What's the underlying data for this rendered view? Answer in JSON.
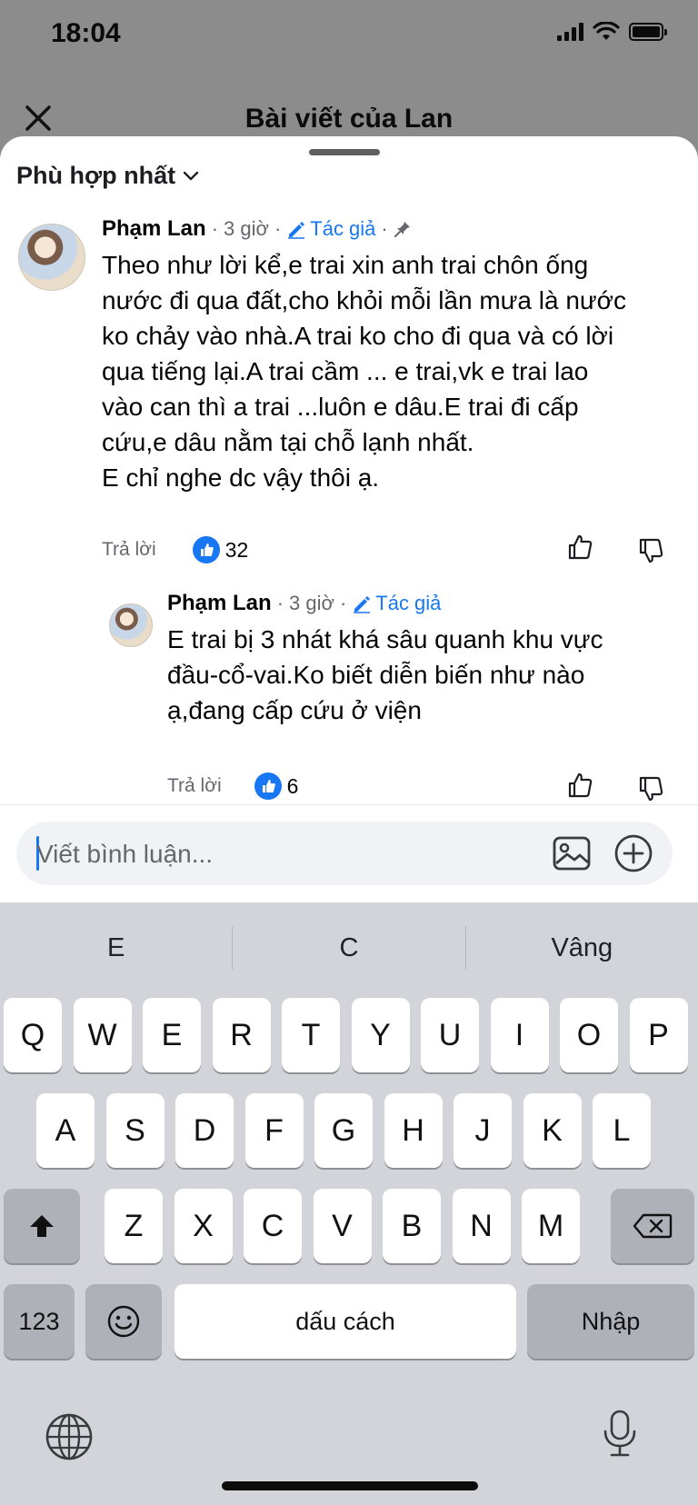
{
  "status_bar": {
    "time": "18:04"
  },
  "header": {
    "title": "Bài viết của Lan"
  },
  "sort": {
    "label": "Phù hợp nhất"
  },
  "comments": [
    {
      "name": "Phạm Lan",
      "time": "3 giờ",
      "author_badge": "Tác giả",
      "pinned": true,
      "text_lines": [
        "Theo như lời kể,e trai xin anh trai chôn ống",
        "nước đi qua đất,cho khỏi mỗi lần mưa là nước",
        "ko chảy vào nhà.A trai ko cho đi qua và có lời",
        "qua tiếng lại.A trai cầm ... e trai,vk e trai  lao",
        "vào can thì a trai ...luôn e dâu.E trai đi cấp",
        "cứu,e dâu nằm tại chỗ lạnh nhất.",
        "E chỉ nghe dc vậy thôi ạ."
      ],
      "reply_label": "Trả lời",
      "likes": "32"
    },
    {
      "name": "Phạm Lan",
      "time": "3 giờ",
      "author_badge": "Tác giả",
      "text_lines": [
        "E trai bị 3 nhát khá sâu quanh khu vực",
        "đầu-cổ-vai.Ko biết diễn biến như nào",
        "ạ,đang cấp cứu ở viện"
      ],
      "reply_label": "Trả lời",
      "likes": "6"
    }
  ],
  "composer": {
    "placeholder": "Viết bình luận...",
    "icons": [
      "photo-icon",
      "plus-circle-icon"
    ]
  },
  "keyboard": {
    "suggestions": [
      "E",
      "C",
      "Vâng"
    ],
    "row1": [
      "Q",
      "W",
      "E",
      "R",
      "T",
      "Y",
      "U",
      "I",
      "O",
      "P"
    ],
    "row2": [
      "A",
      "S",
      "D",
      "F",
      "G",
      "H",
      "J",
      "K",
      "L"
    ],
    "row3": [
      "Z",
      "X",
      "C",
      "V",
      "B",
      "N",
      "M"
    ],
    "numbers_key": "123",
    "space_key": "dấu cách",
    "return_key": "Nhập"
  },
  "colors": {
    "accent": "#1877f2",
    "keyboard_bg": "#d2d4d9"
  }
}
